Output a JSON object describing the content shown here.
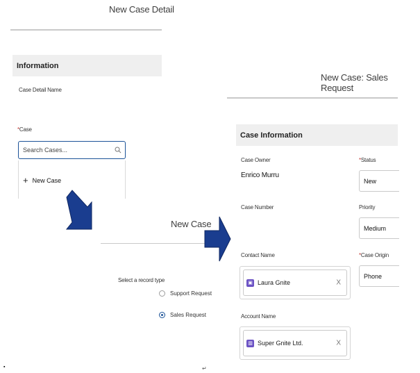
{
  "panel1": {
    "title": "New Case Detail",
    "section": "Information",
    "detail_name_label": "Case Detail Name",
    "case_label": "Case",
    "case_required": "*",
    "search_placeholder": "Search Cases...",
    "new_case_label": "New Case",
    "new_case_plus": "+"
  },
  "panel2": {
    "title": "New Case",
    "prompt": "Select a record type",
    "options": [
      {
        "label": "Support Request",
        "selected": false
      },
      {
        "label": "Sales Request",
        "selected": true
      }
    ]
  },
  "panel3": {
    "title": "New Case: Sales Request",
    "section": "Case Information",
    "owner_label": "Case Owner",
    "owner_value": "Enrico Murru",
    "status_label": "Status",
    "status_value": "New",
    "case_number_label": "Case Number",
    "priority_label": "Priority",
    "priority_value": "Medium",
    "contact_label": "Contact Name",
    "contact_value": "Laura Gnite",
    "origin_label": "Case Origin",
    "origin_value": "Phone",
    "account_label": "Account Name",
    "account_value": "Super Gnite Ltd.",
    "required_mark": "*",
    "remove_glyph": "X"
  },
  "footer": {
    "bullet": "▪",
    "return_glyph": "↵"
  },
  "colors": {
    "arrow": "#1a3d8f",
    "selected_radio": "#1b5297",
    "required": "#c23934",
    "section_bg": "#efefef",
    "lookup_icon": "#6b52c4"
  }
}
